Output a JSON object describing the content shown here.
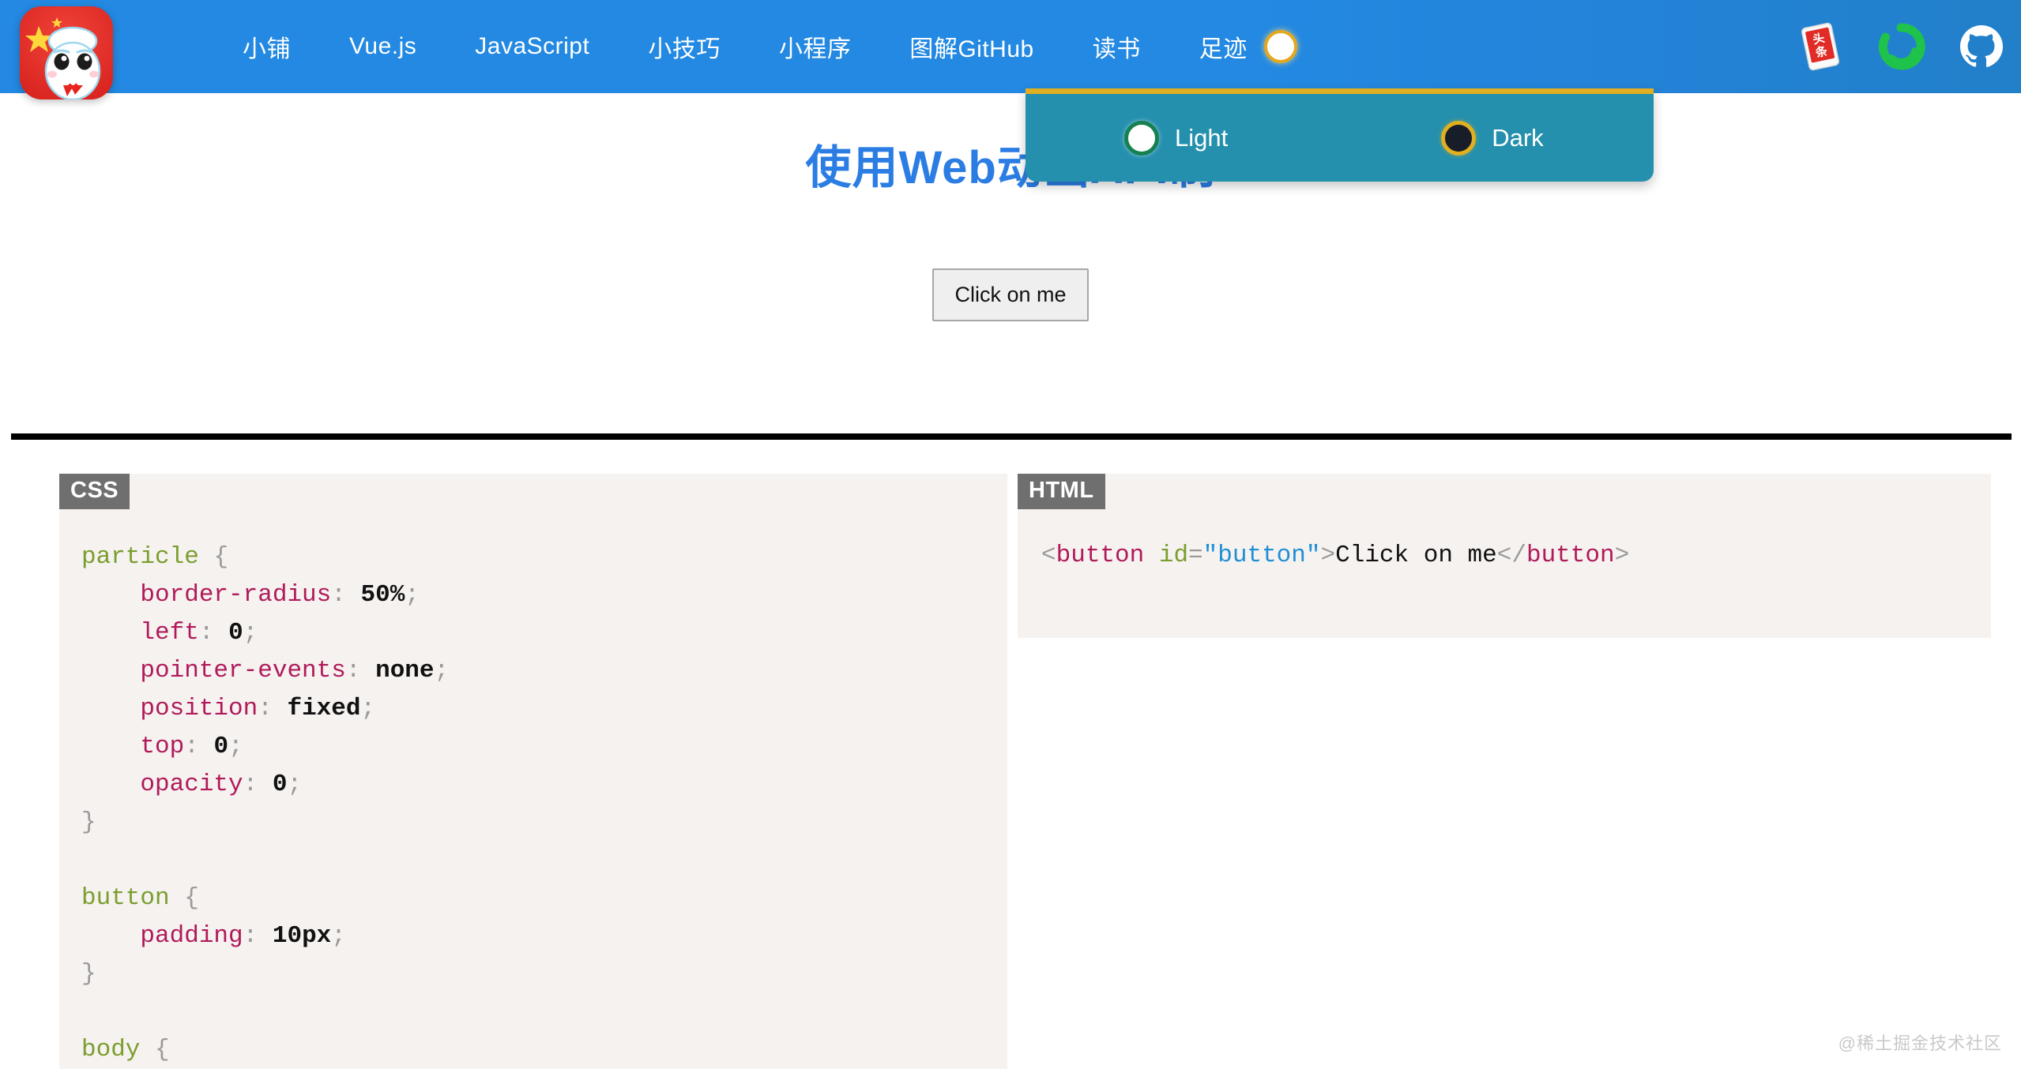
{
  "navbar": {
    "background_color": "#2389e2",
    "logo_name": "site-logo-avatar",
    "links": [
      {
        "label": "小铺"
      },
      {
        "label": "Vue.js"
      },
      {
        "label": "JavaScript"
      },
      {
        "label": "小技巧"
      },
      {
        "label": "小程序"
      },
      {
        "label": "图解GitHub"
      },
      {
        "label": "读书"
      },
      {
        "label": "足迹"
      }
    ],
    "theme_toggle": {
      "name": "theme-toggle-circle",
      "state": "light"
    },
    "icons": [
      {
        "name": "toutiao-icon",
        "label": "头条"
      },
      {
        "name": "juejin-icon",
        "label": "掘金"
      },
      {
        "name": "github-icon",
        "label": "GitHub"
      }
    ]
  },
  "theme_panel": {
    "visible": true,
    "background_color": "#2490ad",
    "border_top_color": "#e0b020",
    "options": [
      {
        "label": "Light",
        "swatch_color": "#ffffff",
        "ring_color": "#158050",
        "selected": true
      },
      {
        "label": "Dark",
        "swatch_color": "#181d2a",
        "ring_color": "#e0b020",
        "selected": false
      }
    ]
  },
  "page": {
    "title": "使用Web动画API制",
    "title_color": "#2b7de4"
  },
  "demo": {
    "button_label": "Click on me"
  },
  "code_panels": {
    "css": {
      "tag": "CSS",
      "lines": [
        {
          "parts": [
            {
              "t": "particle",
              "c": "t-sel"
            },
            {
              "t": " ",
              "c": "t-punc"
            },
            {
              "t": "{",
              "c": "t-punc"
            }
          ]
        },
        {
          "parts": [
            {
              "t": "    ",
              "c": "t-punc"
            },
            {
              "t": "border-radius",
              "c": "t-prop"
            },
            {
              "t": ": ",
              "c": "t-punc"
            },
            {
              "t": "50%",
              "c": "t-val"
            },
            {
              "t": ";",
              "c": "t-punc"
            }
          ]
        },
        {
          "parts": [
            {
              "t": "    ",
              "c": "t-punc"
            },
            {
              "t": "left",
              "c": "t-prop"
            },
            {
              "t": ": ",
              "c": "t-punc"
            },
            {
              "t": "0",
              "c": "t-val"
            },
            {
              "t": ";",
              "c": "t-punc"
            }
          ]
        },
        {
          "parts": [
            {
              "t": "    ",
              "c": "t-punc"
            },
            {
              "t": "pointer-events",
              "c": "t-prop"
            },
            {
              "t": ": ",
              "c": "t-punc"
            },
            {
              "t": "none",
              "c": "t-val"
            },
            {
              "t": ";",
              "c": "t-punc"
            }
          ]
        },
        {
          "parts": [
            {
              "t": "    ",
              "c": "t-punc"
            },
            {
              "t": "position",
              "c": "t-prop"
            },
            {
              "t": ": ",
              "c": "t-punc"
            },
            {
              "t": "fixed",
              "c": "t-val"
            },
            {
              "t": ";",
              "c": "t-punc"
            }
          ]
        },
        {
          "parts": [
            {
              "t": "    ",
              "c": "t-punc"
            },
            {
              "t": "top",
              "c": "t-prop"
            },
            {
              "t": ": ",
              "c": "t-punc"
            },
            {
              "t": "0",
              "c": "t-val"
            },
            {
              "t": ";",
              "c": "t-punc"
            }
          ]
        },
        {
          "parts": [
            {
              "t": "    ",
              "c": "t-punc"
            },
            {
              "t": "opacity",
              "c": "t-prop"
            },
            {
              "t": ": ",
              "c": "t-punc"
            },
            {
              "t": "0",
              "c": "t-val"
            },
            {
              "t": ";",
              "c": "t-punc"
            }
          ]
        },
        {
          "parts": [
            {
              "t": "}",
              "c": "t-punc"
            }
          ]
        },
        {
          "parts": [
            {
              "t": " ",
              "c": "t-punc"
            }
          ]
        },
        {
          "parts": [
            {
              "t": "button",
              "c": "t-sel"
            },
            {
              "t": " ",
              "c": "t-punc"
            },
            {
              "t": "{",
              "c": "t-punc"
            }
          ]
        },
        {
          "parts": [
            {
              "t": "    ",
              "c": "t-punc"
            },
            {
              "t": "padding",
              "c": "t-prop"
            },
            {
              "t": ": ",
              "c": "t-punc"
            },
            {
              "t": "10px",
              "c": "t-val"
            },
            {
              "t": ";",
              "c": "t-punc"
            }
          ]
        },
        {
          "parts": [
            {
              "t": "}",
              "c": "t-punc"
            }
          ]
        },
        {
          "parts": [
            {
              "t": " ",
              "c": "t-punc"
            }
          ]
        },
        {
          "parts": [
            {
              "t": "body",
              "c": "t-sel"
            },
            {
              "t": " ",
              "c": "t-punc"
            },
            {
              "t": "{",
              "c": "t-punc"
            }
          ]
        }
      ]
    },
    "html": {
      "tag": "HTML",
      "lines": [
        {
          "parts": [
            {
              "t": "<",
              "c": "t-punc"
            },
            {
              "t": "button",
              "c": "t-prop"
            },
            {
              "t": " ",
              "c": "t-punc"
            },
            {
              "t": "id",
              "c": "t-sel"
            },
            {
              "t": "=",
              "c": "t-punc"
            },
            {
              "t": "\"button\"",
              "c": "t-str"
            },
            {
              "t": ">",
              "c": "t-punc"
            },
            {
              "t": "Click on me",
              "c": "t-txt"
            },
            {
              "t": "</",
              "c": "t-punc"
            },
            {
              "t": "button",
              "c": "t-prop"
            },
            {
              "t": ">",
              "c": "t-punc"
            }
          ]
        }
      ]
    }
  },
  "watermark": {
    "text": "@稀土掘金技术社区"
  }
}
